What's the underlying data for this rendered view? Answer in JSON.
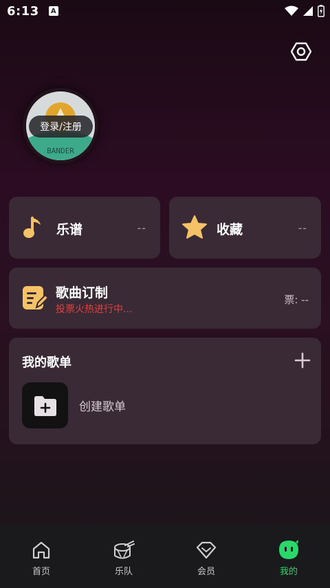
{
  "status_bar": {
    "time": "6:13",
    "notif_letter": "A"
  },
  "profile": {
    "login_label": "登录/注册",
    "avatar_text": "BANDER"
  },
  "quick_cards": {
    "sheet": {
      "label": "乐谱",
      "count": "--"
    },
    "favorites": {
      "label": "收藏",
      "count": "--"
    }
  },
  "custom_song": {
    "title": "歌曲订制",
    "subtitle": "投票火热进行中...",
    "votes_label": "票: --"
  },
  "playlists": {
    "title": "我的歌单",
    "create_label": "创建歌单"
  },
  "tabs": [
    {
      "label": "首页",
      "icon": "home-icon",
      "active": false
    },
    {
      "label": "乐队",
      "icon": "drum-icon",
      "active": false
    },
    {
      "label": "会员",
      "icon": "diamond-icon",
      "active": false
    },
    {
      "label": "我的",
      "icon": "mine-face-icon",
      "active": true
    }
  ],
  "colors": {
    "accent_green": "#2bd66a",
    "subtitle_red": "#e0413e",
    "icon_gold": "#f6c267"
  }
}
